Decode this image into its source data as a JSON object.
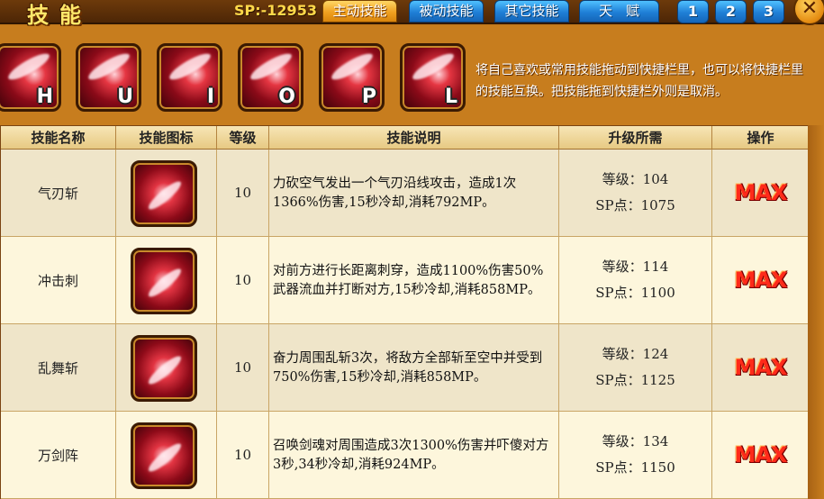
{
  "header": {
    "title": "技能",
    "sp": "SP:-12953",
    "tabs": [
      "主动技能",
      "被动技能",
      "其它技能",
      "天　赋"
    ],
    "pages": [
      "1",
      "2",
      "3"
    ]
  },
  "hotbar": {
    "keys": [
      "H",
      "U",
      "I",
      "O",
      "P",
      "L"
    ],
    "hint": "将自己喜欢或常用技能拖动到快捷栏里，也可以将快捷栏里的技能互换。把技能拖到快捷栏外则是取消。"
  },
  "table": {
    "headers": [
      "技能名称",
      "技能图标",
      "等级",
      "技能说明",
      "升级所需",
      "操作"
    ],
    "rows": [
      {
        "name": "气刃斩",
        "level": "10",
        "desc": "力砍空气发出一个气刃沿线攻击，造成1次1366%伤害,15秒冷却,消耗792MP。",
        "req_level": "等级：104",
        "req_sp": "SP点：1075",
        "action": "MAX"
      },
      {
        "name": "冲击刺",
        "level": "10",
        "desc": "对前方进行长距离刺穿，造成1100%伤害50%武器流血并打断对方,15秒冷却,消耗858MP。",
        "req_level": "等级：114",
        "req_sp": "SP点：1100",
        "action": "MAX"
      },
      {
        "name": "乱舞斩",
        "level": "10",
        "desc": "奋力周围乱斩3次，将敌方全部斩至空中并受到750%伤害,15秒冷却,消耗858MP。",
        "req_level": "等级：124",
        "req_sp": "SP点：1125",
        "action": "MAX"
      },
      {
        "name": "万剑阵",
        "level": "10",
        "desc": "召唤剑魂对周围造成3次1300%伤害并吓傻对方3秒,34秒冷却,消耗924MP。",
        "req_level": "等级：134",
        "req_sp": "SP点：1150",
        "action": "MAX"
      }
    ]
  }
}
